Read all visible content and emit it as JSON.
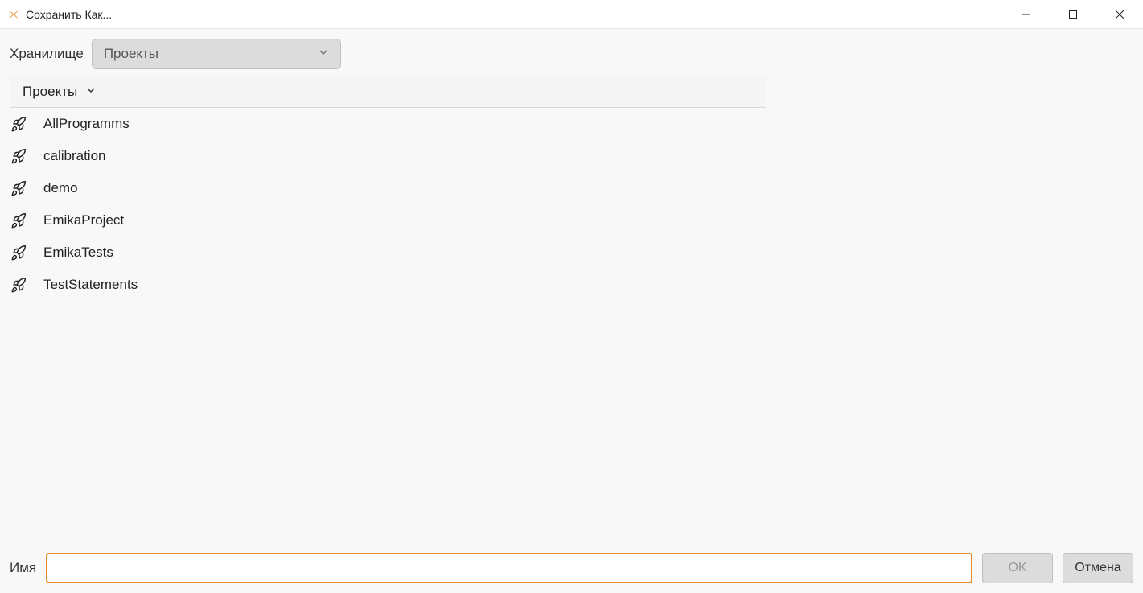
{
  "window": {
    "title": "Сохранить Как..."
  },
  "storage": {
    "label": "Хранилище",
    "selected": "Проекты"
  },
  "breadcrumb": {
    "current": "Проекты"
  },
  "items": [
    {
      "label": "AllProgramms"
    },
    {
      "label": "calibration"
    },
    {
      "label": "demo"
    },
    {
      "label": "EmikaProject"
    },
    {
      "label": "EmikaTests"
    },
    {
      "label": "TestStatements"
    }
  ],
  "name": {
    "label": "Имя",
    "value": ""
  },
  "buttons": {
    "ok": "OK",
    "cancel": "Отмена"
  }
}
